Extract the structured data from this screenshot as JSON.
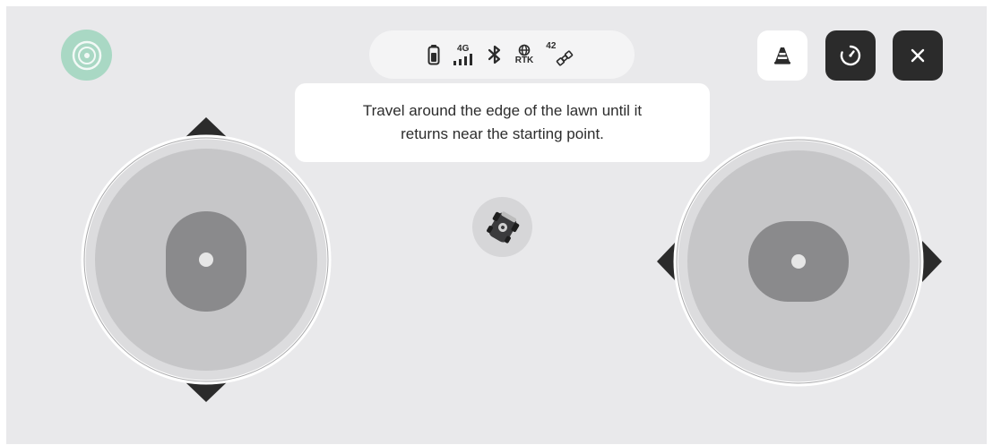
{
  "tooltip": {
    "line1": "Travel around the edge of the lawn until it",
    "line2": "returns near the starting point."
  },
  "status_bar": {
    "network_label": "4G",
    "rtk_label": "RTK",
    "satellite_count": "42"
  },
  "icons": {
    "logo": "logo-icon",
    "battery": "battery-icon",
    "signal": "cellular-signal-icon",
    "bluetooth": "bluetooth-icon",
    "rtk": "rtk-globe-icon",
    "satellite": "satellite-icon",
    "cone": "traffic-cone-icon",
    "rotate": "rotate-icon",
    "close": "close-icon",
    "mower": "mower-icon"
  },
  "colors": {
    "background": "#e9e9eb",
    "logo_accent": "#a9d8c4",
    "dark_button": "#2b2b2b",
    "joystick_base": "#c6c6c8",
    "joystick_knob": "#8a8a8c"
  }
}
